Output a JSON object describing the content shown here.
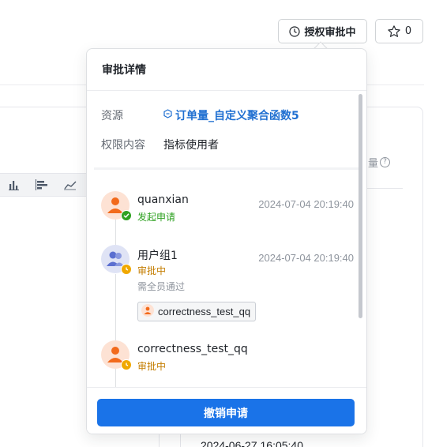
{
  "toolbar": {
    "approval_button_label": "授权审批中",
    "star_count": "0"
  },
  "background": {
    "metric_label_partial": "量",
    "help_glyph": "?",
    "date_partial": "2024-06-27 16:05:40"
  },
  "popover": {
    "title": "审批详情",
    "resource_label": "资源",
    "resource_value": "订单量_自定义聚合函数5",
    "permission_label": "权限内容",
    "permission_value": "指标使用者",
    "cancel_button_label": "撤销申请"
  },
  "timeline": [
    {
      "name": "quanxian",
      "status": "发起申请",
      "status_color": "#2ea121",
      "time": "2024-07-04 20:19:40",
      "avatar_type": "person-icon",
      "badge": "check-icon"
    },
    {
      "name": "用户组1",
      "status": "审批中",
      "status_color": "#c47d00",
      "time": "2024-07-04 20:19:40",
      "note": "需全员通过",
      "members": [
        "correctness_test_qq"
      ],
      "avatar_type": "group-icon",
      "badge": "clock-icon"
    },
    {
      "name": "correctness_test_qq",
      "status": "审批中",
      "status_color": "#c47d00",
      "avatar_type": "person-icon",
      "badge": "clock-icon"
    }
  ],
  "colors": {
    "primary": "#1a73e8",
    "link": "#1f6fd1",
    "success": "#2ea121",
    "pending": "#f0a800",
    "avatar_person_bg": "#fde2d4",
    "avatar_person_fg": "#f26a1b",
    "avatar_group_bg": "#dfe3f5",
    "avatar_group_fg": "#5b6fd0"
  }
}
